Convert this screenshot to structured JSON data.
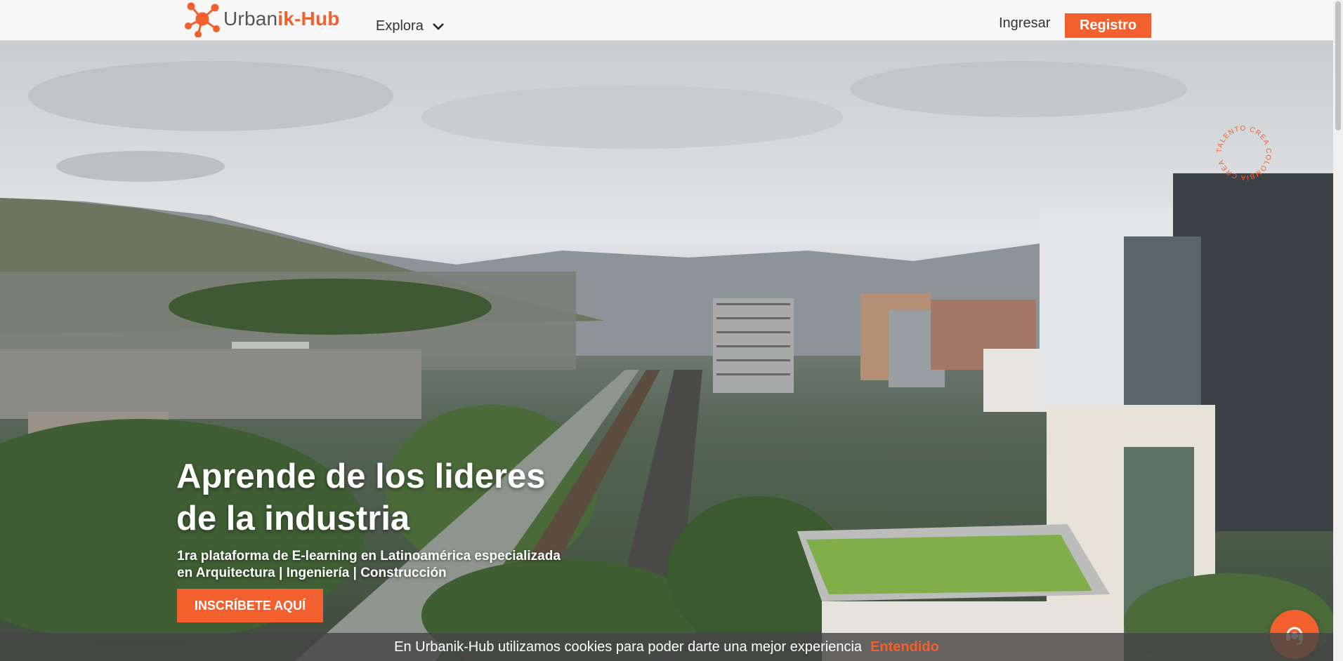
{
  "header": {
    "logo_part1": "Urban",
    "logo_part2": "ik-Hub",
    "explora_label": "Explora",
    "ingresar_label": "Ingresar",
    "registro_label": "Registro"
  },
  "hero": {
    "badge_text": "TALENTO CREA COLOMBIA CREA ",
    "title_line1": "Aprende de los lideres",
    "title_line2": "de la industria",
    "subtitle_line1": "1ra plataforma de E-learning en Latinoamérica especializada",
    "subtitle_line2": "en Arquitectura | Ingeniería | Construcción",
    "cta_label": "INSCRÍBETE AQUÍ"
  },
  "cookie_bar": {
    "message": "En Urbanik-Hub utilizamos cookies para poder darte una mejor experiencia",
    "accept_label": "Entendido"
  },
  "colors": {
    "accent": "#f2602e",
    "header_bg": "#f7f7f7",
    "cookie_bg": "#464646"
  },
  "icons": {
    "logo": "molecule-logo-icon",
    "explora": "chevron-down-icon",
    "help": "headset-support-icon"
  }
}
